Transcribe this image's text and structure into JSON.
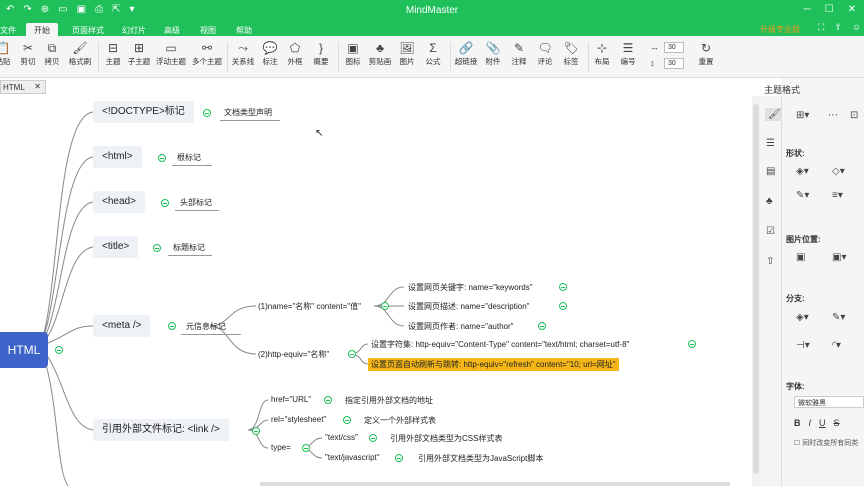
{
  "app": {
    "title": "MindMaster",
    "upgrade": "升级专业版"
  },
  "menu": {
    "tabs": [
      {
        "label": "文件"
      },
      {
        "label": "开始"
      },
      {
        "label": "页面样式"
      },
      {
        "label": "幻灯片"
      },
      {
        "label": "高级"
      },
      {
        "label": "视图"
      },
      {
        "label": "帮助"
      }
    ],
    "active": "开始"
  },
  "ribbon": {
    "paste": "粘贴",
    "cut": "剪切",
    "copy": "拷贝",
    "format_painter": "格式刷",
    "topic": "主题",
    "subtopic": "子主题",
    "floating_topic": "浮动主题",
    "multi_topic": "多个主题",
    "relationship": "关系线",
    "callout": "标注",
    "boundary": "外框",
    "summary": "概要",
    "icon": "图标",
    "clipart": "剪贴画",
    "image": "图片",
    "formula": "公式",
    "hyperlink": "超链接",
    "attachment": "附件",
    "note": "注释",
    "comment": "评论",
    "tag": "标签",
    "layout": "布局",
    "numbering": "编号",
    "spacing_h": "30",
    "spacing_v": "30",
    "reset": "重置"
  },
  "document": {
    "tab": "HTML"
  },
  "panel": {
    "header": "主题格式",
    "shape": "形状:",
    "image_position": "图片位置:",
    "branch": "分支:",
    "font": "字体:",
    "font_name": "微软雅黑",
    "sync_label": "同时改变所有同类"
  },
  "mindmap": {
    "root": "HTML",
    "topics": [
      {
        "label": "<!DOCTYPE>标记",
        "desc": "文档类型声明"
      },
      {
        "label": "<html>",
        "desc": "根标记"
      },
      {
        "label": "<head>",
        "desc": "头部标记"
      },
      {
        "label": "<title>",
        "desc": "标题标记"
      },
      {
        "label": "<meta />",
        "desc": "元信息标记"
      },
      {
        "label": "引用外部文件标记: <link />",
        "desc": ""
      }
    ],
    "meta": {
      "name_branch": "(1)name=\"名称\" content=\"值\"",
      "name_children": [
        "设置网页关键字: name=\"keywords\"",
        "设置网页描述: name=\"description\"",
        "设置网页作者: name=\"author\""
      ],
      "http_branch": "(2)http-equiv=\"名称\"",
      "http_children": [
        "设置字符集: http-equiv=\"Content-Type\" content=\"text/html; charset=utf-8\"",
        "设置页面自动刷新与跳转: http-equiv=\"refresh\" content=\"10; url=网址\""
      ]
    },
    "link": {
      "href": "href=\"URL\"",
      "href_desc": "指定引用外部文档的地址",
      "rel": "rel=\"stylesheet\"",
      "rel_desc": "定义一个外部样式表",
      "type": "type=",
      "type_css": "\"text/css\"",
      "type_css_desc": "引用外部文档类型为CSS样式表",
      "type_js": "\"text/javascript\"",
      "type_js_desc": "引用外部文档类型为JavaScript脚本"
    }
  },
  "colors": {
    "accent": "#1fbf5a",
    "root": "#3d63c9",
    "highlight": "#f5b718",
    "upgrade": "#f39b1c"
  }
}
